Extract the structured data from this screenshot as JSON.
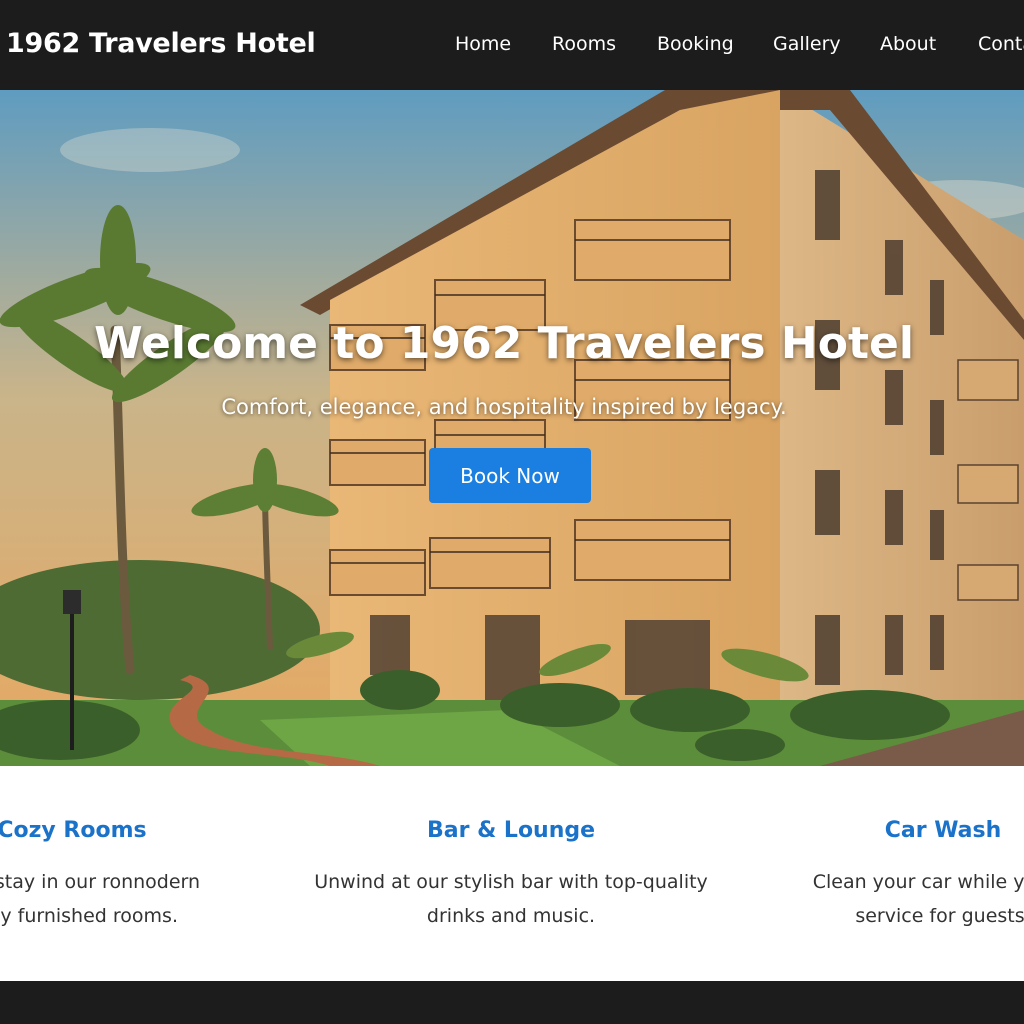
{
  "header": {
    "brand": "1962 Travelers Hotel",
    "nav": [
      {
        "label": "Home"
      },
      {
        "label": "Rooms"
      },
      {
        "label": "Booking"
      },
      {
        "label": "Gallery"
      },
      {
        "label": "About"
      },
      {
        "label": "Conta"
      }
    ]
  },
  "hero": {
    "title": "Welcome to 1962 Travelers Hotel",
    "subtitle": "Comfort, elegance, and hospitality inspired by legacy.",
    "cta_label": "Book Now",
    "image_icon": "hotel-building-photo"
  },
  "features": [
    {
      "title": "Cozy Rooms",
      "lines": [
        "wing stay in our ronnodern",
        "milly furnished rooms."
      ]
    },
    {
      "title": "Bar & Lounge",
      "lines": [
        "Unwind at our stylish bar with top-quality",
        "drinks and music."
      ]
    },
    {
      "title": "Car Wash",
      "lines": [
        "Clean your car while you re",
        "service for guests,"
      ]
    }
  ],
  "colors": {
    "header_bg": "#1c1c1c",
    "accent": "#1a7fe0",
    "feature_title": "#1a72c9",
    "footer_bg": "#1c1c1c"
  }
}
